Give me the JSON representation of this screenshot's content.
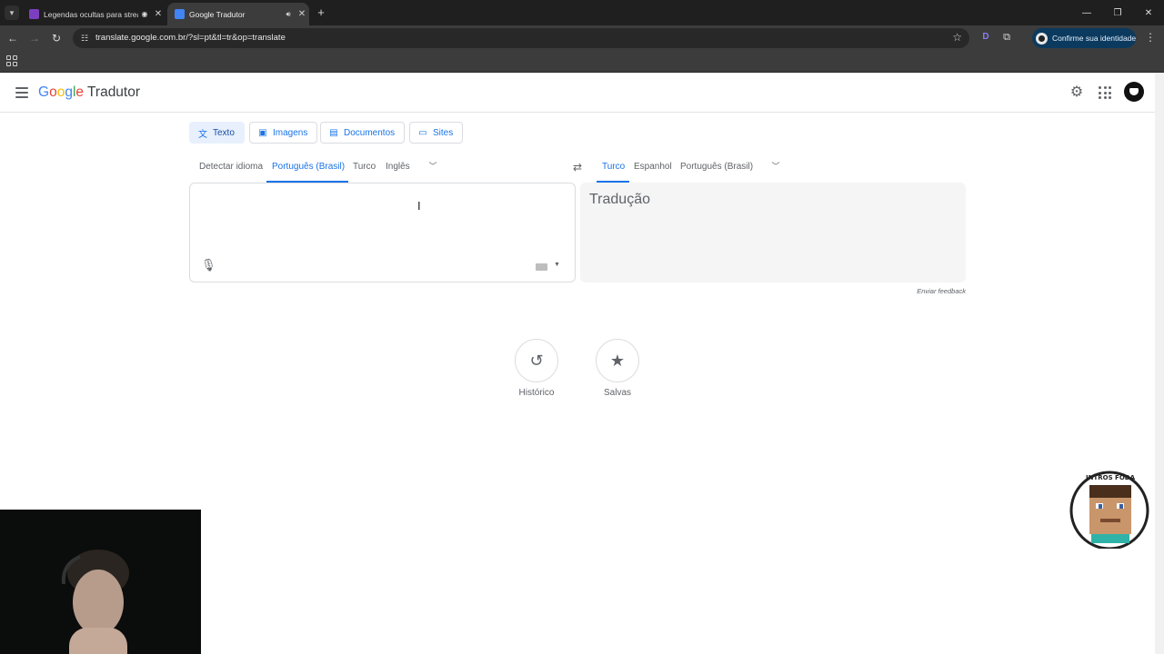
{
  "browser": {
    "tabs": [
      {
        "title": "Legendas ocultas para strea",
        "active": false,
        "favicon_color": "#7b3fbf"
      },
      {
        "title": "Google Tradutor",
        "active": true,
        "favicon_color": "#4285f4"
      }
    ],
    "url": "translate.google.com.br/?sl=pt&tl=tr&op=translate",
    "identity_chip": "Confirme sua identidade",
    "extension_letter": "D"
  },
  "page": {
    "logo": {
      "g1": "G",
      "o1": "o",
      "o2": "o",
      "g2": "g",
      "l": "l",
      "e": "e",
      "product": "Tradutor"
    },
    "mode_tabs": [
      {
        "label": "Texto",
        "icon": "translate-icon",
        "active": true
      },
      {
        "label": "Imagens",
        "icon": "image-icon",
        "active": false
      },
      {
        "label": "Documentos",
        "icon": "document-icon",
        "active": false
      },
      {
        "label": "Sites",
        "icon": "web-icon",
        "active": false
      }
    ],
    "source_langs": [
      "Detectar idioma",
      "Português (Brasil)",
      "Turco",
      "Inglês"
    ],
    "source_active": "Português (Brasil)",
    "target_langs": [
      "Turco",
      "Espanhol",
      "Português (Brasil)"
    ],
    "target_active": "Turco",
    "source_text": "",
    "target_placeholder": "Tradução",
    "feedback": "Enviar feedback",
    "history_label": "Histórico",
    "saved_label": "Salvas",
    "sticker_text_top": "INTROS FODA",
    "accent_color": "#1a73e8"
  }
}
